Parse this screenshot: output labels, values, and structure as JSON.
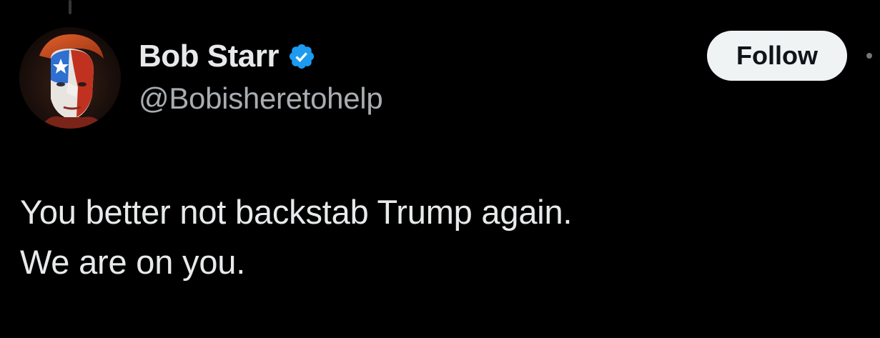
{
  "author": {
    "display_name": "Bob Starr",
    "handle": "@Bobisheretohelp",
    "verified": true,
    "avatar_icon": "profile-portrait-avatar"
  },
  "actions": {
    "follow_label": "Follow"
  },
  "tweet": {
    "lines": [
      "You better not backstab Trump again.",
      "We are on you."
    ]
  },
  "colors": {
    "background": "#000000",
    "text_primary": "#e7e9ea",
    "text_secondary": "#a9adb1",
    "verified_badge": "#1d9bf0",
    "follow_button_bg": "#eff3f4",
    "follow_button_text": "#0f1419"
  }
}
